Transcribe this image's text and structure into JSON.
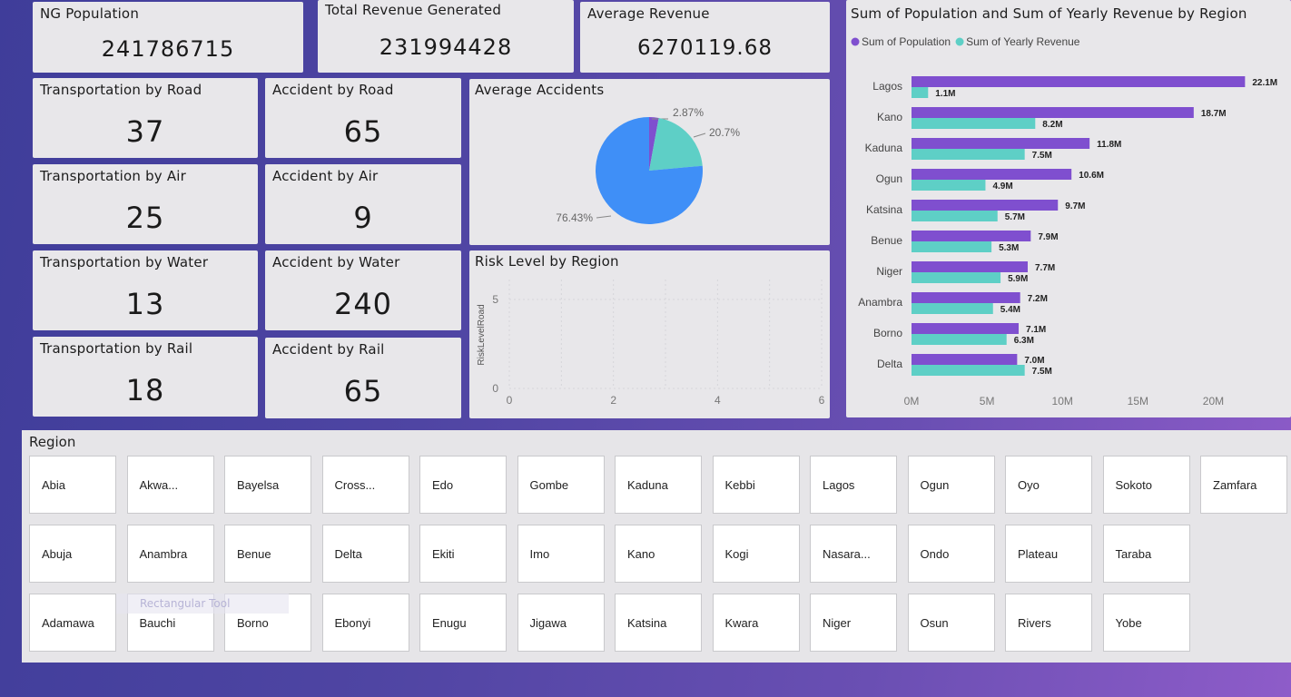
{
  "kpis": {
    "ng_population": {
      "label": "NG Population",
      "value": "241786715"
    },
    "total_revenue": {
      "label": "Total Revenue Generated",
      "value": "231994428"
    },
    "average_revenue": {
      "label": "Average Revenue",
      "value": "6270119.68"
    },
    "transport_road": {
      "label": "Transportation by Road",
      "value": "37"
    },
    "transport_air": {
      "label": "Transportation by Air",
      "value": "25"
    },
    "transport_water": {
      "label": "Transportation by Water",
      "value": "13"
    },
    "transport_rail": {
      "label": "Transportation by Rail",
      "value": "18"
    },
    "accident_road": {
      "label": "Accident by Road",
      "value": "65"
    },
    "accident_air": {
      "label": "Accident by Air",
      "value": "9"
    },
    "accident_water": {
      "label": "Accident by Water",
      "value": "240"
    },
    "accident_rail": {
      "label": "Accident by Rail",
      "value": "65"
    }
  },
  "colors": {
    "purple": "#7f4fcf",
    "teal": "#5ecfc6",
    "blue": "#3f8ff7"
  },
  "chart_data": [
    {
      "type": "pie",
      "title": "Average Accidents",
      "slices": [
        {
          "value": 2.87,
          "label": "2.87%",
          "color": "#7f4fcf"
        },
        {
          "value": 20.7,
          "label": "20.7%",
          "color": "#5ecfc6"
        },
        {
          "value": 76.43,
          "label": "76.43%",
          "color": "#3f8ff7"
        }
      ]
    },
    {
      "type": "scatter",
      "title": "Risk Level by Region",
      "ylabel": "RiskLevelRoad",
      "xlim": [
        0,
        6
      ],
      "ylim": [
        0,
        5
      ],
      "x_ticks": [
        "0",
        "2",
        "4",
        "6"
      ],
      "y_ticks": [
        "0",
        "5"
      ],
      "points": []
    },
    {
      "type": "bar",
      "orientation": "horizontal",
      "title": "Sum of Population and Sum of Yearly Revenue by Region",
      "legend": "top-left",
      "categories": [
        "Lagos",
        "Kano",
        "Kaduna",
        "Ogun",
        "Katsina",
        "Benue",
        "Niger",
        "Anambra",
        "Borno",
        "Delta"
      ],
      "series": [
        {
          "name": "Sum of Population",
          "color": "#7f4fcf",
          "values": [
            22.1,
            18.7,
            11.8,
            10.6,
            9.7,
            7.9,
            7.7,
            7.2,
            7.1,
            7.0
          ],
          "labels": [
            "22.1M",
            "18.7M",
            "11.8M",
            "10.6M",
            "9.7M",
            "7.9M",
            "7.7M",
            "7.2M",
            "7.1M",
            "7.0M"
          ]
        },
        {
          "name": "Sum of Yearly Revenue",
          "color": "#5ecfc6",
          "values": [
            1.1,
            8.2,
            7.5,
            4.9,
            5.7,
            5.3,
            5.9,
            5.4,
            6.3,
            7.5
          ],
          "labels": [
            "1.1M",
            "8.2M",
            "7.5M",
            "4.9M",
            "5.7M",
            "5.3M",
            "5.9M",
            "5.4M",
            "6.3M",
            "7.5M"
          ]
        }
      ],
      "xlim": [
        0,
        22.5
      ],
      "x_ticks": [
        "0M",
        "5M",
        "10M",
        "15M",
        "20M"
      ]
    }
  ],
  "region_slicer": {
    "label": "Region",
    "rows": [
      [
        "Abia",
        "Akwa...",
        "Bayelsa",
        "Cross...",
        "Edo",
        "Gombe",
        "Kaduna",
        "Kebbi",
        "Lagos",
        "Ogun",
        "Oyo",
        "Sokoto",
        "Zamfara"
      ],
      [
        "Abuja",
        "Anambra",
        "Benue",
        "Delta",
        "Ekiti",
        "Imo",
        "Kano",
        "Kogi",
        "Nasara...",
        "Ondo",
        "Plateau",
        "Taraba"
      ],
      [
        "Adamawa",
        "Bauchi",
        "Borno",
        "Ebonyi",
        "Enugu",
        "Jigawa",
        "Katsina",
        "Kwara",
        "Niger",
        "Osun",
        "Rivers",
        "Yobe"
      ]
    ]
  },
  "ghost_label": "Rectangular Tool"
}
